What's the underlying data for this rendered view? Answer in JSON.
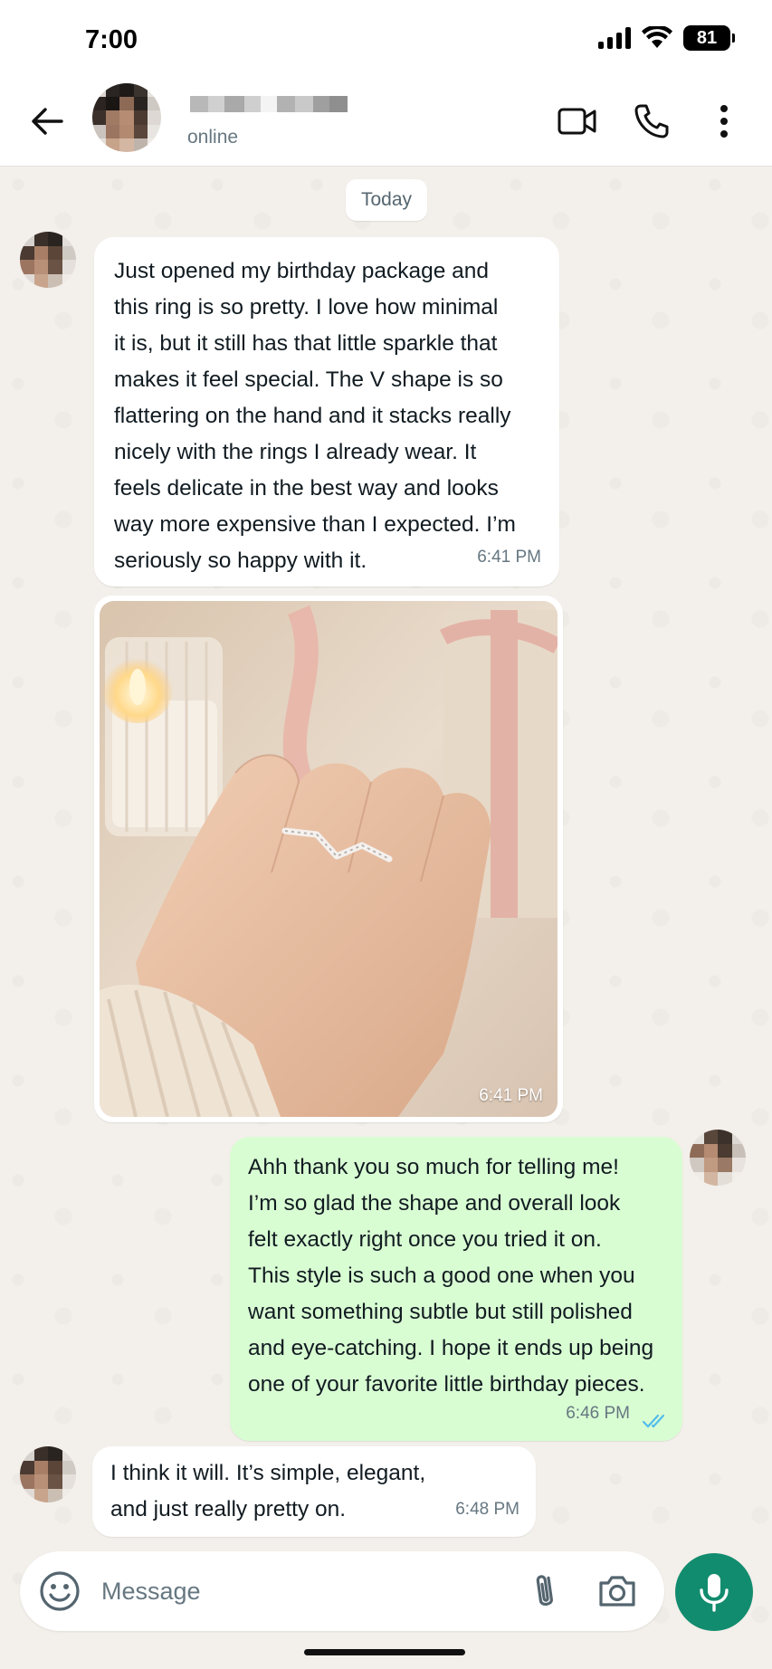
{
  "status_bar": {
    "time": "7:00",
    "battery": "81",
    "icons": [
      "signal-icon",
      "wifi-icon",
      "battery-icon"
    ]
  },
  "header": {
    "status": "online",
    "actions": [
      "video-call-icon",
      "phone-icon",
      "more-vertical-icon"
    ]
  },
  "date_divider": "Today",
  "messages": [
    {
      "direction": "incoming",
      "type": "text",
      "lines": [
        "Just opened my birthday package and",
        "this ring is so pretty. I love how minimal",
        "it is, but it still has that little sparkle that",
        "makes it feel special. The V shape is so",
        "flattering on the hand and it stacks really",
        "nicely with the rings I already wear. It",
        "feels delicate in the best way and looks",
        "way more expensive than I expected. I’m",
        "seriously so happy with it."
      ],
      "time": "6:41 PM"
    },
    {
      "direction": "incoming",
      "type": "image",
      "image_subject": "hand wearing a V-shaped diamond ring, candle and gift box with pink ribbon",
      "time": "6:41 PM"
    },
    {
      "direction": "outgoing",
      "type": "text",
      "lines": [
        "Ahh thank you so much for telling me!",
        "I’m so glad the shape and overall look",
        "felt exactly right once you tried it on.",
        "This style is such a good one when you",
        "want something subtle but still polished",
        "and eye-catching. I hope it ends up being",
        "one of your favorite little birthday pieces."
      ],
      "time": "6:46 PM",
      "read_receipt": "double-check-icon"
    },
    {
      "direction": "incoming",
      "type": "text",
      "lines": [
        "I think it will. It’s simple, elegant,",
        "and just really pretty on."
      ],
      "time": "6:48 PM"
    }
  ],
  "composer": {
    "placeholder": "Message",
    "icons": [
      "emoji-icon",
      "paperclip-icon",
      "camera-icon",
      "microphone-icon"
    ]
  },
  "colors": {
    "incoming_bubble": "#ffffff",
    "outgoing_bubble": "#d9fdd3",
    "accent": "#128c6e",
    "read_tick": "#53bdeb",
    "wallpaper": "#f3efea"
  }
}
